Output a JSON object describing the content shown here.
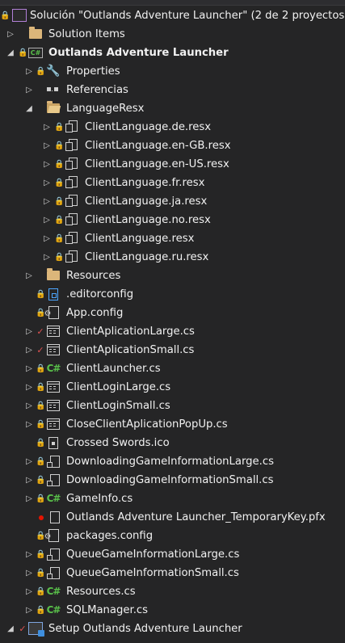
{
  "solution": {
    "label": "Solución \"Outlands Adventure Launcher\" (2 de 2 proyectos"
  },
  "solution_items": {
    "label": "Solution Items"
  },
  "project": {
    "label": "Outlands Adventure Launcher",
    "icon_text": "C#"
  },
  "nodes": {
    "properties": "Properties",
    "referencias": "Referencias",
    "language_folder": "LanguageResx",
    "resx": [
      "ClientLanguage.de.resx",
      "ClientLanguage.en-GB.resx",
      "ClientLanguage.en-US.resx",
      "ClientLanguage.fr.resx",
      "ClientLanguage.ja.resx",
      "ClientLanguage.no.resx",
      "ClientLanguage.resx",
      "ClientLanguage.ru.resx"
    ],
    "resources_folder": "Resources",
    "editorconfig": ".editorconfig",
    "app_config": "App.config",
    "client_app_large": "ClientAplicationLarge.cs",
    "client_app_small": "ClientAplicationSmall.cs",
    "client_launcher": "ClientLauncher.cs",
    "client_login_large": "ClientLoginLarge.cs",
    "client_login_small": "ClientLoginSmall.cs",
    "close_popup": "CloseClientAplicationPopUp.cs",
    "crossed_swords": "Crossed Swords.ico",
    "dl_large": "DownloadingGameInformationLarge.cs",
    "dl_small": "DownloadingGameInformationSmall.cs",
    "gameinfo": "GameInfo.cs",
    "tempkey": "Outlands Adventure Launcher_TemporaryKey.pfx",
    "packages": "packages.config",
    "queue_large": "QueueGameInformationLarge.cs",
    "queue_small": "QueueGameInformationSmall.cs",
    "resources_cs": "Resources.cs",
    "sqlmanager": "SQLManager.cs"
  },
  "setup_project": {
    "label": "Setup Outlands Adventure Launcher"
  },
  "glyphs": {
    "csharp": "C#",
    "check": "✓",
    "lock": "🔒"
  },
  "colors": {
    "background": "#252526",
    "text": "#f1f1f1",
    "lock": "#4da6ff",
    "csharp": "#59c04a",
    "check": "#e05252",
    "folder": "#dcb67a"
  }
}
